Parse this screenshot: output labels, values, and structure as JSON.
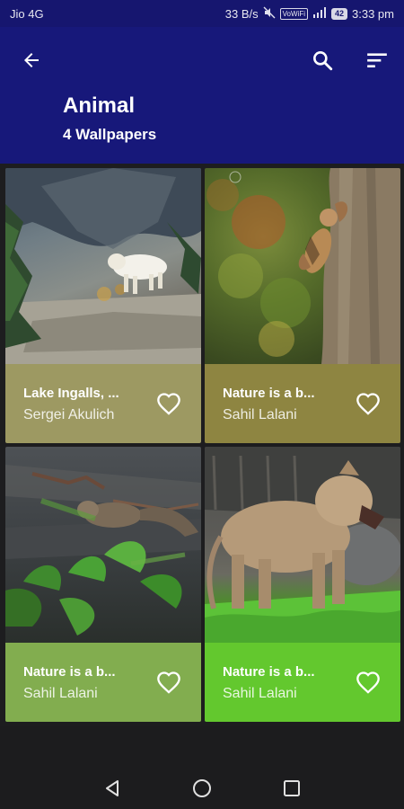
{
  "status_bar": {
    "carrier": "Jio 4G",
    "speed": "33 B/s",
    "vowifi": "VoWiFi",
    "battery": "42",
    "time": "3:33 pm",
    "icons": [
      "mute-icon",
      "vowifi-icon",
      "signal-icon",
      "battery-icon"
    ]
  },
  "app_bar": {
    "title": "Animal",
    "subtitle": "4 Wallpapers",
    "icons": {
      "back": "arrow-back-icon",
      "search": "search-icon",
      "sort": "sort-icon"
    },
    "color": "#17187a"
  },
  "wallpapers": [
    {
      "name": "Lake Ingalls, ...",
      "author": "Sergei Akulich",
      "card_color": "#9d9962",
      "photo": "mountain goat on rocky slope",
      "favorite_icon": "heart-outline-icon"
    },
    {
      "name": "Nature is a b...",
      "author": "Sahil Lalani",
      "card_color": "#8e8541",
      "photo": "squirrel on tree trunk",
      "favorite_icon": "heart-outline-icon"
    },
    {
      "name": "Nature is a b...",
      "author": "Sahil Lalani",
      "card_color": "#82ad4f",
      "photo": "squirrel among leaves",
      "favorite_icon": "heart-outline-icon"
    },
    {
      "name": "Nature is a b...",
      "author": "Sahil Lalani",
      "card_color": "#63c82e",
      "photo": "lioness on grass",
      "favorite_icon": "heart-outline-icon"
    }
  ],
  "nav_bar": {
    "icons": [
      "back-triangle-icon",
      "home-circle-icon",
      "recents-square-icon"
    ]
  }
}
